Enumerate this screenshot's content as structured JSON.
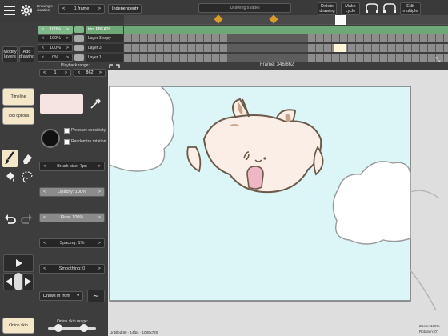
{
  "header": {
    "drawing_duration_label": "Drawing's duration",
    "duration_value": "1 frame",
    "mode_value": "Independent",
    "drawing_label_placeholder": "Drawing's label",
    "delete_drawing": "Delete drawing",
    "make_cycle": "Make cycle",
    "edit_multiple": "Edit multiple"
  },
  "layers": [
    {
      "opacity": "100%",
      "name": "trim.FBEA26...",
      "active": true
    },
    {
      "opacity": "100%",
      "name": "Layer 3 copy",
      "active": false
    },
    {
      "opacity": "100%",
      "name": "Layer 3",
      "active": false
    },
    {
      "opacity": "0%",
      "name": "Layer 1",
      "active": false
    }
  ],
  "layer_buttons": {
    "modify": "Modify layers",
    "add": "Add drawing"
  },
  "playback": {
    "label": "Playback range:",
    "start": "1",
    "end": "862"
  },
  "frame_readout": "Frame: 346/862",
  "side_tabs": {
    "timeline": "Timeline",
    "tool_options": "Tool options",
    "onion_skin": "Onion skin"
  },
  "tool_options": {
    "pressure_sensitivity": "Pressure sensitivity",
    "randomize_rotation": "Randomize rotation",
    "brush_size": "Brush size: 7px",
    "opacity": "Opacity: 100%",
    "flow": "Flow: 100%",
    "spacing": "Spacing: 1%",
    "smoothing": "Smoothing: 0",
    "draw_mode": "Draws in front",
    "onion_skin_range": "Onion skin range:"
  },
  "sliders": {
    "opacity_fraction": 1.0,
    "flow_fraction": 1.0
  },
  "canvas": {
    "bg_color": "#dcf5f6",
    "status_left": "Untitled 80 · 14fps · 1080x720",
    "zoom": "Zoom: 136%",
    "rotation": "Rotation: 0°"
  },
  "icons": {
    "menu": "hamburger-icon",
    "settings": "gear-icon",
    "brush": "brush-icon",
    "eraser": "eraser-icon",
    "fill": "bucket-icon",
    "lasso": "lasso-icon",
    "undo": "undo-icon",
    "redo": "redo-icon",
    "eyedropper": "eyedropper-icon",
    "fullscreen": "expand-icon",
    "play": "play-icon",
    "prev": "prev-frame-icon",
    "next": "next-frame-icon"
  }
}
